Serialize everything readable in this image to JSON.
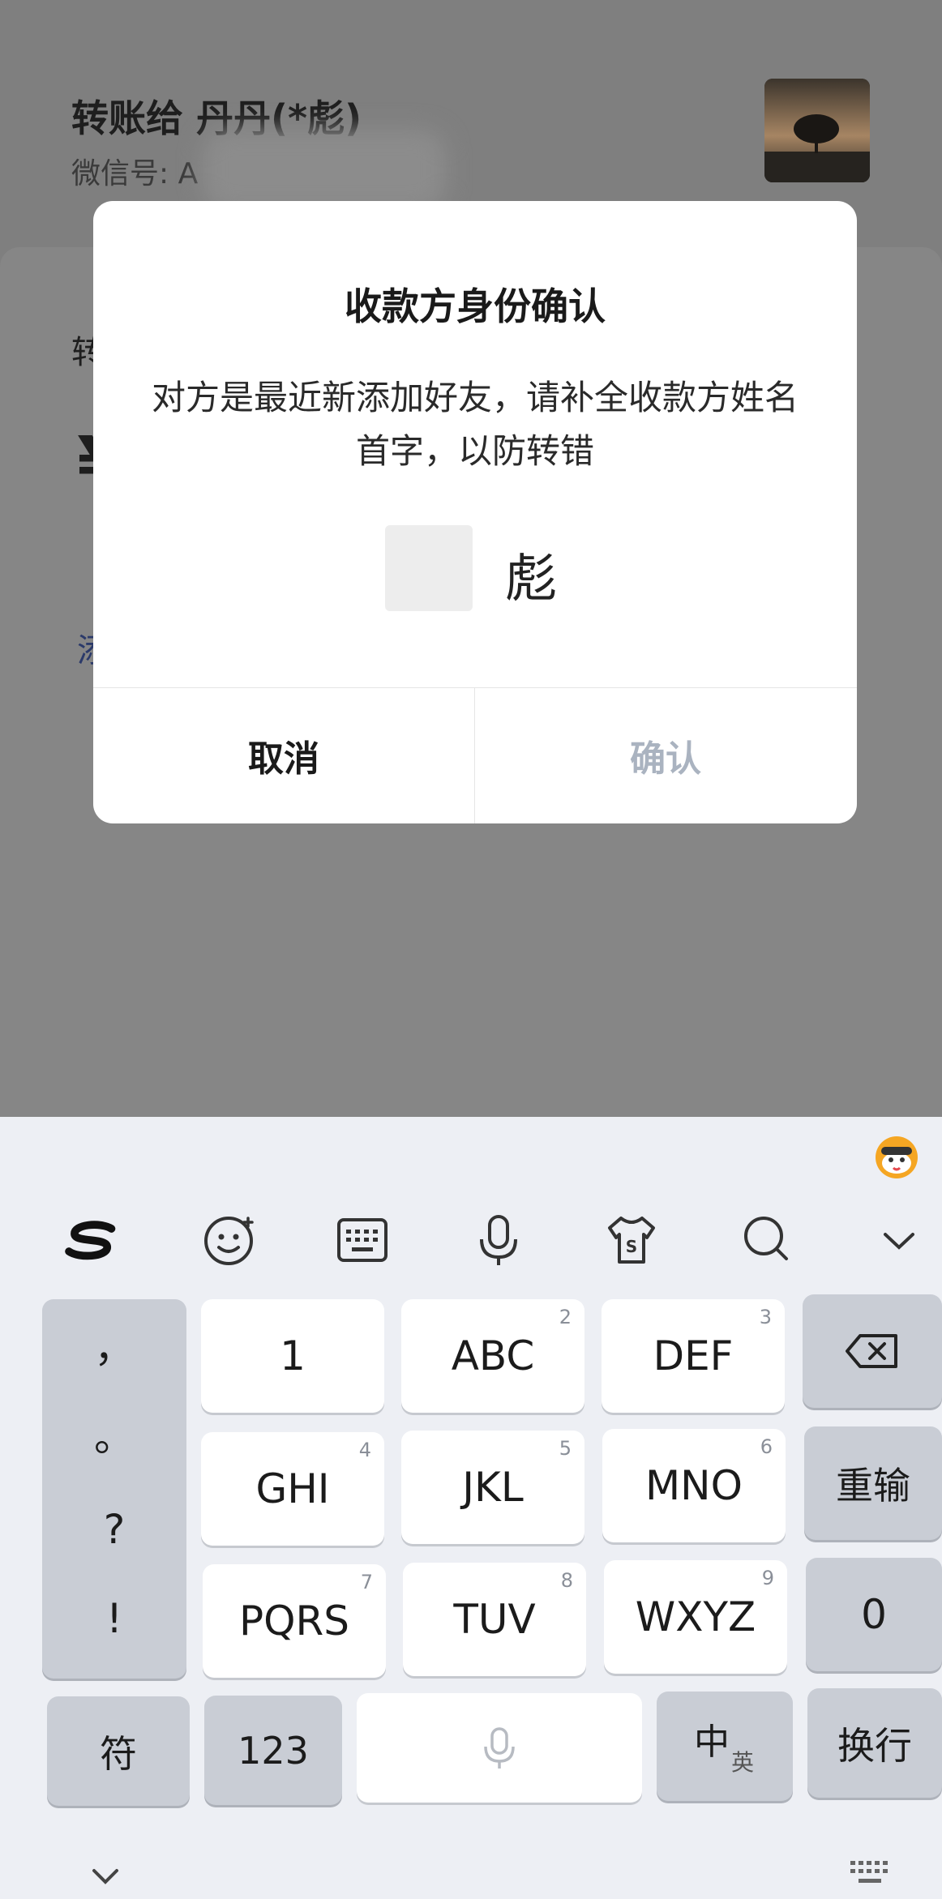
{
  "page": {
    "title": "转账给 丹丹(*彪)",
    "subtitle": "微信号: A",
    "fragment_1": "转",
    "fragment_2": "¥",
    "fragment_3": "添"
  },
  "dialog": {
    "title": "收款方身份确认",
    "message": "对方是最近新添加好友，请补全收款方姓名首字，以防转错",
    "name_suffix": "彪",
    "cancel_label": "取消",
    "confirm_label": "确认"
  },
  "keyboard": {
    "toolbar": [
      "sogou-logo-icon",
      "emoji-icon",
      "keyboard-icon",
      "microphone-icon",
      "skin-icon",
      "search-icon",
      "collapse-icon"
    ],
    "punctuation": [
      "，",
      "。",
      "?",
      "!"
    ],
    "rows": [
      [
        {
          "label": "1",
          "sub": ""
        },
        {
          "label": "ABC",
          "sub": "2"
        },
        {
          "label": "DEF",
          "sub": "3"
        }
      ],
      [
        {
          "label": "GHI",
          "sub": "4"
        },
        {
          "label": "JKL",
          "sub": "5"
        },
        {
          "label": "MNO",
          "sub": "6"
        }
      ],
      [
        {
          "label": "PQRS",
          "sub": "7"
        },
        {
          "label": "TUV",
          "sub": "8"
        },
        {
          "label": "WXYZ",
          "sub": "9"
        }
      ]
    ],
    "right_keys": {
      "retype": "重输",
      "zero": "0",
      "newline": "换行"
    },
    "bottom": {
      "symbols": "符",
      "numbers": "123",
      "lang_main": "中",
      "lang_sub": "英"
    }
  },
  "colors": {
    "overlay": "#808080",
    "dialog_bg": "#ffffff",
    "confirm_disabled": "#aab3c0",
    "keyboard_bg": "#edeff4"
  }
}
